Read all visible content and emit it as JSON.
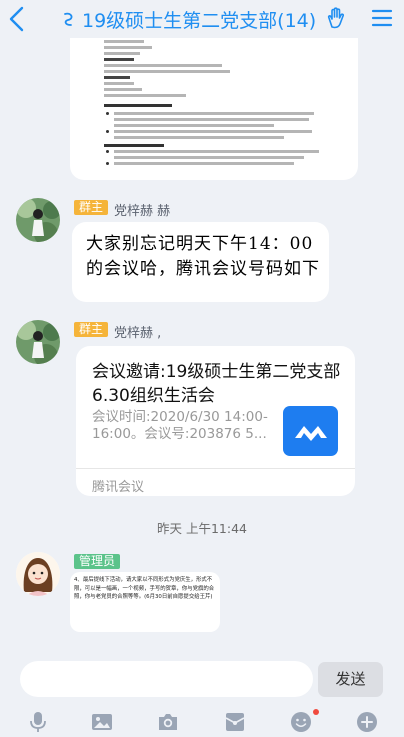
{
  "header": {
    "title": "19级硕士生第二党支部(14)",
    "back_icon": "chevron-left-icon",
    "group_icon": "group-chat-icon",
    "hand_icon": "hand-wave-icon",
    "menu_icon": "menu-icon",
    "accent_color": "#1f8ef1"
  },
  "messages": [
    {
      "type": "document-image",
      "avatar_icon": "user-avatar-icon"
    },
    {
      "type": "text",
      "role_badge": "群主",
      "sender": "党梓赫 赫",
      "body": "大家别忘记明天下午14：00的会议哈，腾讯会议号码如下",
      "badge_color": "#f5b43a"
    },
    {
      "type": "card",
      "role_badge": "群主",
      "sender": "党梓赫 ,",
      "card_title": "会议邀请:19级硕士生第二党支部 6.30组织生活会",
      "card_desc": "会议时间:2020/6/30 14:00-16:00。会议号:203876 5...",
      "card_source": "腾讯会议",
      "card_icon": "tencent-meeting-icon"
    },
    {
      "type": "timestamp",
      "text": "昨天 上午11:44"
    },
    {
      "type": "text-image",
      "role_badge": "管理员",
      "badge_color": "#5bc38a",
      "image_text": "4、最后提线下活动，请大家以不同形式为党庆生，形式不限，可以是一幅画，一个视频，手写的贺章，你与党旗的合照，你与老党员的合照等等。(6月30日前自愿提交给王芹)"
    }
  ],
  "composer": {
    "placeholder": "",
    "send_label": "发送"
  },
  "toolbar": {
    "items": [
      "microphone-icon",
      "image-icon",
      "camera-icon",
      "red-packet-icon",
      "emoji-icon",
      "plus-icon"
    ]
  }
}
